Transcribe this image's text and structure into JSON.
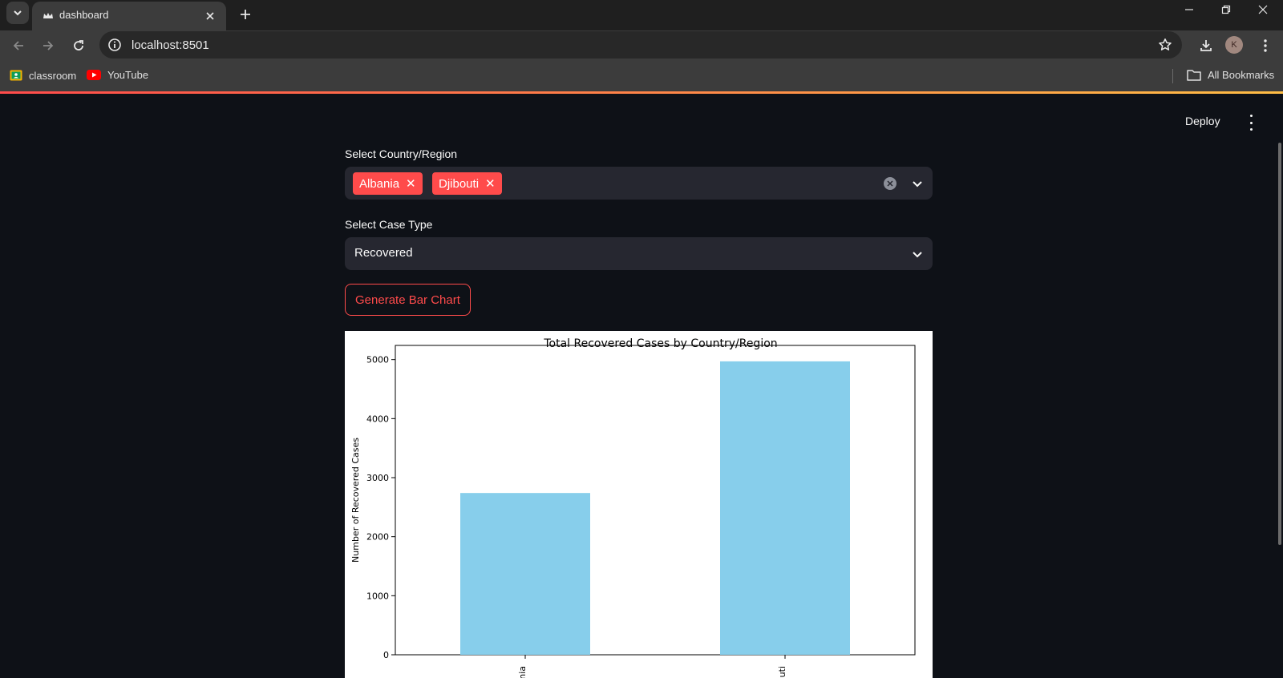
{
  "browser": {
    "tab_title": "dashboard",
    "url": "localhost:8501",
    "profile_initial": "K",
    "bookmarks": [
      {
        "label": "classroom",
        "icon": "classroom-icon"
      },
      {
        "label": "YouTube",
        "icon": "youtube-icon"
      }
    ],
    "all_bookmarks_label": "All Bookmarks"
  },
  "app": {
    "deploy_label": "Deploy",
    "country_label": "Select Country/Region",
    "selected_countries": [
      "Albania",
      "Djibouti"
    ],
    "case_type_label": "Select Case Type",
    "case_type_value": "Recovered",
    "button_label": "Generate Bar Chart",
    "accent_color": "#ff4b4b"
  },
  "chart_data": {
    "type": "bar",
    "title": "Total Recovered Cases by Country/Region",
    "ylabel": "Number of Recovered Cases",
    "xlabel": "",
    "categories": [
      "Albania",
      "Djibouti"
    ],
    "values": [
      2740,
      4970
    ],
    "ylim": [
      0,
      5240
    ],
    "yticks": [
      0,
      1000,
      2000,
      3000,
      4000,
      5000
    ],
    "bar_color": "#87ceeb",
    "grid": false
  }
}
